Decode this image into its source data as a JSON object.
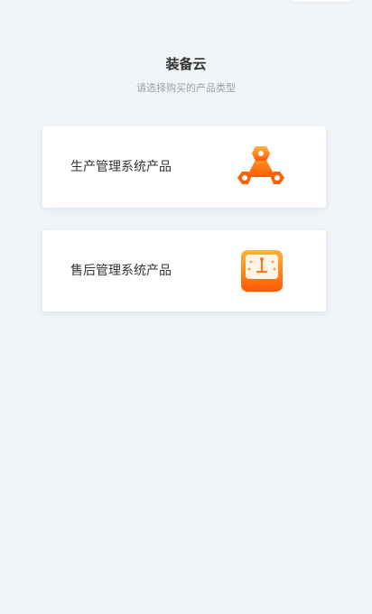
{
  "header": {
    "title": "装备云",
    "subtitle": "请选择购买的产品类型"
  },
  "products": [
    {
      "label": "生产管理系统产品",
      "icon": "production-hub-icon"
    },
    {
      "label": "售后管理系统产品",
      "icon": "aftersales-gauge-icon"
    }
  ],
  "colors": {
    "background": "#f2f5f7",
    "card": "#ffffff",
    "accent_orange": "#ff6a00",
    "accent_light": "#ffa033",
    "text_primary": "#333333",
    "text_secondary": "#9aa0a6"
  }
}
